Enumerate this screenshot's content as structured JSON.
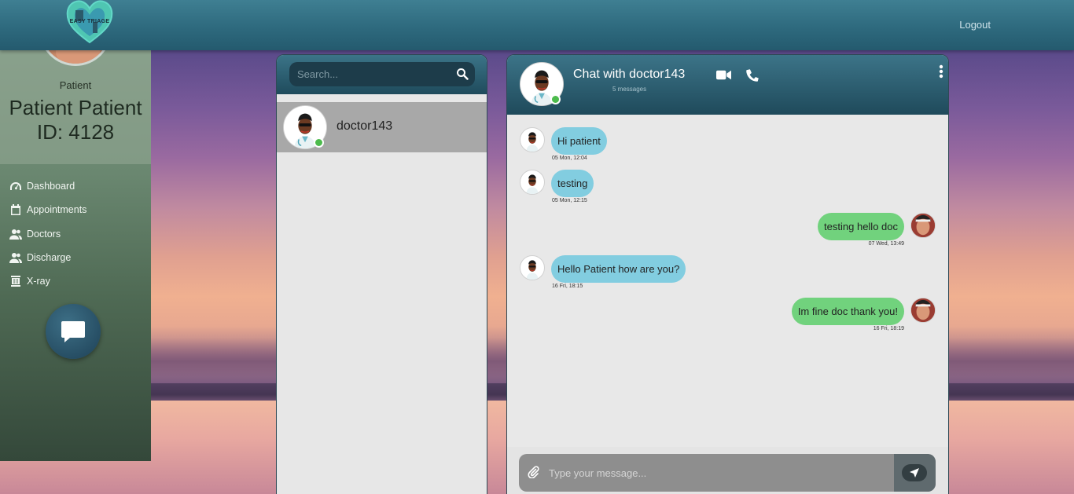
{
  "header": {
    "logo_text": "EASY TRIAGE",
    "logout_label": "Logout"
  },
  "sidebar": {
    "role": "Patient",
    "name": "Patient Patient",
    "id_line": "ID: 4128",
    "items": [
      {
        "label": "Dashboard",
        "icon": "gauge-icon"
      },
      {
        "label": "Appointments",
        "icon": "calendar-icon"
      },
      {
        "label": "Doctors",
        "icon": "users-icon"
      },
      {
        "label": "Discharge",
        "icon": "users-icon"
      },
      {
        "label": "X-ray",
        "icon": "xray-icon"
      }
    ]
  },
  "contacts": {
    "search_placeholder": "Search...",
    "list": [
      {
        "name": "doctor143",
        "online": true
      }
    ]
  },
  "chat": {
    "title": "Chat with doctor143",
    "subtitle": "5 messages",
    "input_placeholder": "Type your message...",
    "messages": [
      {
        "direction": "in",
        "text": "Hi patient",
        "time": "05 Mon, 12:04"
      },
      {
        "direction": "in",
        "text": "testing",
        "time": "05 Mon, 12:15"
      },
      {
        "direction": "out",
        "text": "testing hello doc",
        "time": "07 Wed, 13:49"
      },
      {
        "direction": "in",
        "text": "Hello Patient how are you?",
        "time": "16 Fri, 18:15"
      },
      {
        "direction": "out",
        "text": "Im fine doc thank you!",
        "time": "16 Fri, 18:19"
      }
    ]
  },
  "colors": {
    "incoming_bubble": "#82cde0",
    "outgoing_bubble": "#71d27d",
    "online": "#4cbb4c",
    "header": "#2e6a7e"
  }
}
